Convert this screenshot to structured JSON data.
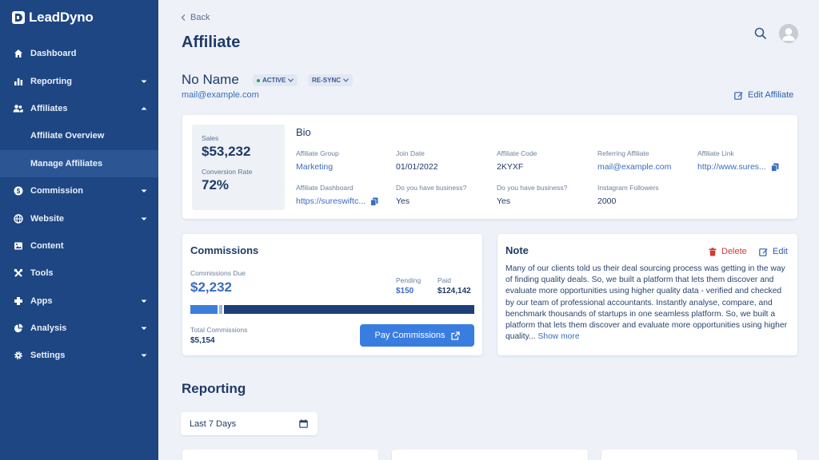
{
  "brand": {
    "name": "LeadDyno"
  },
  "sidebar": {
    "items": [
      {
        "label": "Dashboard",
        "icon": "home-icon"
      },
      {
        "label": "Reporting",
        "icon": "bar-chart-icon"
      },
      {
        "label": "Affiliates",
        "icon": "users-icon"
      },
      {
        "label": "Commission",
        "icon": "dollar-icon"
      },
      {
        "label": "Website",
        "icon": "globe-icon"
      },
      {
        "label": "Content",
        "icon": "image-icon"
      },
      {
        "label": "Tools",
        "icon": "tools-icon"
      },
      {
        "label": "Apps",
        "icon": "apps-icon"
      },
      {
        "label": "Analysis",
        "icon": "pie-chart-icon"
      },
      {
        "label": "Settings",
        "icon": "gear-icon"
      }
    ],
    "sub_items": [
      {
        "label": "Affiliate Overview"
      },
      {
        "label": "Manage Affiliates"
      }
    ]
  },
  "header": {
    "back_label": "Back",
    "title": "Affiliate"
  },
  "affiliate": {
    "name": "No Name",
    "status_badge": "ACTIVE",
    "resync_badge": "RE-SYNC",
    "email": "mail@example.com",
    "edit_label": "Edit Affiliate"
  },
  "stats": {
    "sales_label": "Sales",
    "sales_value": "$53,232",
    "conversion_label": "Conversion Rate",
    "conversion_value": "72%"
  },
  "bio": {
    "title": "Bio",
    "fields": [
      {
        "label": "Affiliate Group",
        "value": "Marketing"
      },
      {
        "label": "Join Date",
        "value": "01/01/2022"
      },
      {
        "label": "Affiliate Code",
        "value": "2KYXF"
      },
      {
        "label": "Referring Affiliate",
        "value": "mail@example.com"
      },
      {
        "label": "Affiliate Link",
        "value": "http://www.sures..."
      },
      {
        "label": "Affiliate Dashboard",
        "value": "https://sureswiftc..."
      },
      {
        "label": "Do you have business?",
        "value": "Yes"
      },
      {
        "label": "Do you have business?",
        "value": "Yes"
      },
      {
        "label": "Instagram Followers",
        "value": "2000"
      }
    ]
  },
  "commissions": {
    "title": "Commissions",
    "due_label": "Commissions Due",
    "due_value": "$2,232",
    "pending_label": "Pending",
    "pending_value": "$150",
    "paid_label": "Paid",
    "paid_value": "$124,142",
    "total_label": "Total Commissions",
    "total_value": "$5,154",
    "pay_button": "Pay Commissions"
  },
  "note": {
    "title": "Note",
    "delete_label": "Delete",
    "edit_label": "Edit",
    "text": "Many of our clients told us their deal sourcing process was getting in the way of finding quality deals. So, we built a platform that lets them discover and evaluate more opportunities using higher quality data - verified and checked by our team of professional accountants. Instantly analyse, compare, and benchmark thousands of startups in one seamless platform. So, we built a platform that lets them discover and evaluate more opportunities using higher quality...",
    "show_more": "Show more"
  },
  "reporting": {
    "title": "Reporting",
    "date_range": "Last 7 Days"
  },
  "colors": {
    "sidebar_bg": "#1d4683",
    "accent": "#3a7de0",
    "danger": "#d23a3a",
    "page_bg": "#eef2f8"
  }
}
